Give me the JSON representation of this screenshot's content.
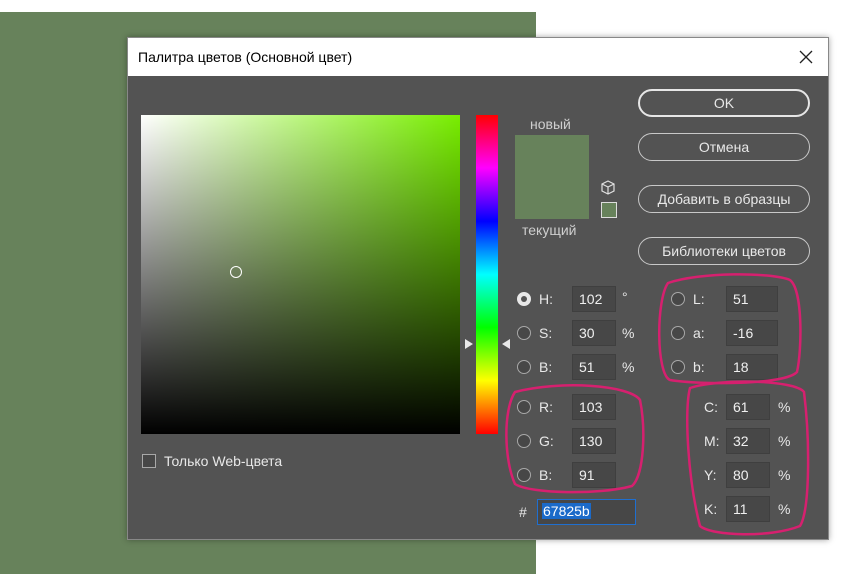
{
  "background_color": "#67825b",
  "dialog": {
    "title": "Палитра цветов (Основной цвет)",
    "close_icon": "close-icon"
  },
  "color_field": {
    "hue_color": "#78ee00"
  },
  "preview": {
    "new_label": "новый",
    "current_label": "текущий",
    "new_color": "#67825b",
    "current_color": "#67825b"
  },
  "buttons": {
    "ok": "OK",
    "cancel": "Отмена",
    "add_to_swatches": "Добавить в образцы",
    "color_libraries": "Библиотеки цветов"
  },
  "hsb": [
    {
      "label": "H:",
      "value": "102",
      "unit": "°",
      "checked": true
    },
    {
      "label": "S:",
      "value": "30",
      "unit": "%",
      "checked": false
    },
    {
      "label": "B:",
      "value": "51",
      "unit": "%",
      "checked": false
    }
  ],
  "rgb": [
    {
      "label": "R:",
      "value": "103"
    },
    {
      "label": "G:",
      "value": "130"
    },
    {
      "label": "B:",
      "value": "91"
    }
  ],
  "lab": [
    {
      "label": "L:",
      "value": "51"
    },
    {
      "label": "a:",
      "value": "-16"
    },
    {
      "label": "b:",
      "value": "18"
    }
  ],
  "cmyk": [
    {
      "label": "C:",
      "value": "61",
      "unit": "%"
    },
    {
      "label": "M:",
      "value": "32",
      "unit": "%"
    },
    {
      "label": "Y:",
      "value": "80",
      "unit": "%"
    },
    {
      "label": "K:",
      "value": "11",
      "unit": "%"
    }
  ],
  "hex": {
    "symbol": "#",
    "value": "67825b"
  },
  "web_only": {
    "label": "Только Web-цвета",
    "checked": false
  },
  "annotation_color": "#d6206f"
}
